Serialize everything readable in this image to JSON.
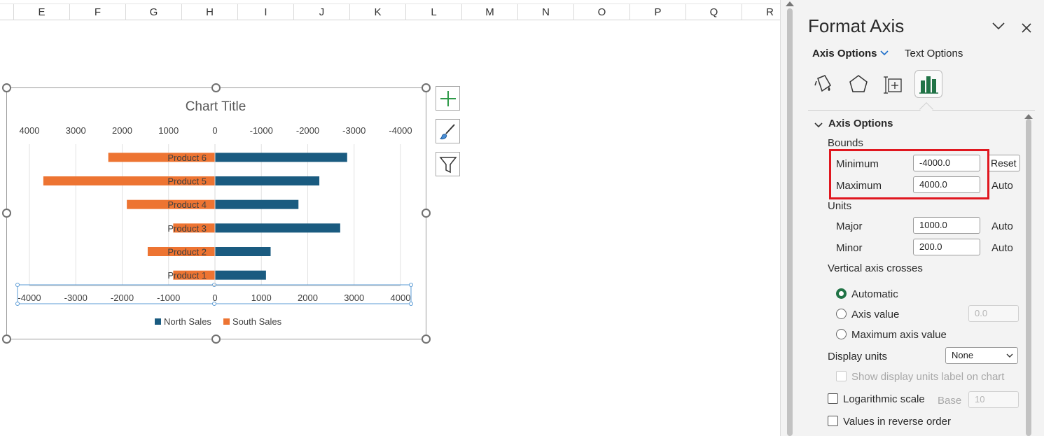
{
  "columns": [
    "E",
    "F",
    "G",
    "H",
    "I",
    "J",
    "K",
    "L",
    "M",
    "N",
    "O",
    "P",
    "Q",
    "R"
  ],
  "chart": {
    "title": "Chart Title",
    "categories": [
      "Product 6",
      "Product 5",
      "Product 4",
      "Product 3",
      "Product 2",
      "Product 1"
    ],
    "top_ticks": [
      "4000",
      "3000",
      "2000",
      "1000",
      "0",
      "-1000",
      "-2000",
      "-3000",
      "-4000"
    ],
    "bottom_ticks": [
      "-4000",
      "-3000",
      "-2000",
      "-1000",
      "0",
      "1000",
      "2000",
      "3000",
      "4000"
    ],
    "legend": [
      {
        "name": "North Sales",
        "color": "#1a5b80"
      },
      {
        "name": "South Sales",
        "color": "#ed7432"
      }
    ]
  },
  "chart_data": {
    "type": "bar",
    "orientation": "horizontal",
    "title": "Chart Title",
    "categories": [
      "Product 6",
      "Product 5",
      "Product 4",
      "Product 3",
      "Product 2",
      "Product 1"
    ],
    "series": [
      {
        "name": "North Sales",
        "color": "#1a5b80",
        "values": [
          2850,
          2250,
          1800,
          2700,
          1200,
          1100
        ]
      },
      {
        "name": "South Sales",
        "color": "#ed7432",
        "values": [
          -2300,
          -3700,
          -1900,
          -900,
          -1450,
          -900
        ]
      }
    ],
    "xlim": [
      -4000,
      4000
    ],
    "major_unit": 1000,
    "grid": true,
    "legend_position": "bottom"
  },
  "chart_buttons": {
    "add": "plus-icon",
    "style": "brush-icon",
    "filter": "funnel-icon"
  },
  "pane": {
    "title": "Format Axis",
    "tab_axis": "Axis Options",
    "tab_text": "Text Options",
    "section": "Axis Options",
    "bounds_label": "Bounds",
    "minimum_label": "Minimum",
    "minimum_value": "-4000.0",
    "minimum_action": "Reset",
    "maximum_label": "Maximum",
    "maximum_value": "4000.0",
    "maximum_action": "Auto",
    "units_label": "Units",
    "major_label": "Major",
    "major_value": "1000.0",
    "major_action": "Auto",
    "minor_label": "Minor",
    "minor_value": "200.0",
    "minor_action": "Auto",
    "crosses_label": "Vertical axis crosses",
    "opt_automatic": "Automatic",
    "opt_axis_value": "Axis value",
    "axis_value_placeholder": "0.0",
    "opt_max_axis": "Maximum axis value",
    "display_units_label": "Display units",
    "display_units_value": "None",
    "show_units_label": "Show display units label on chart",
    "log_scale_label": "Logarithmic scale",
    "base_label": "Base",
    "base_value": "10",
    "reverse_label": "Values in reverse order"
  }
}
